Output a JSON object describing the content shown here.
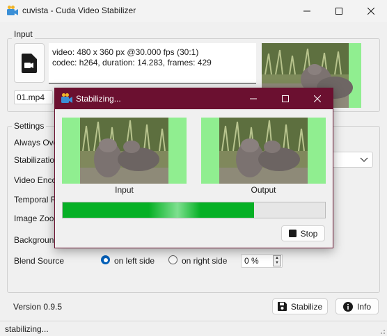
{
  "window": {
    "title": "cuvista - Cuda Video Stabilizer",
    "icon": "cuvista-camera-icon"
  },
  "input_group": {
    "label": "Input",
    "video_info_line1": "video: 480 x 360 px @30.000 fps (30:1)",
    "video_info_line2": "codec: h264, duration: 14.283, frames: 429",
    "file_name": "01.mp4",
    "file_icon": "video-file-icon"
  },
  "settings_group": {
    "label": "Settings",
    "rows": [
      {
        "label": "Always Ove"
      },
      {
        "label": "Stabilizatio"
      },
      {
        "label": "Video Enco"
      },
      {
        "label": "Temporal R"
      },
      {
        "label": "Image Zoo"
      },
      {
        "label": "Backgroun"
      },
      {
        "label": "Blend Source"
      }
    ],
    "blend_source": {
      "options": [
        "on left side",
        "on right side"
      ],
      "selected": "on left side",
      "value": "0 %"
    }
  },
  "footer": {
    "version": "Version 0.9.5",
    "stabilize_label": "Stabilize",
    "info_label": "Info"
  },
  "status": {
    "text": "stabilizing..."
  },
  "dialog": {
    "title": "Stabilizing...",
    "input_caption": "Input",
    "output_caption": "Output",
    "progress": 0.73,
    "stop_label": "Stop"
  },
  "colors": {
    "dialog_titlebar": "#6b1030",
    "progress_fill": "#06b025",
    "preview_background": "#90ee90",
    "radio_accent": "#005fb8"
  }
}
